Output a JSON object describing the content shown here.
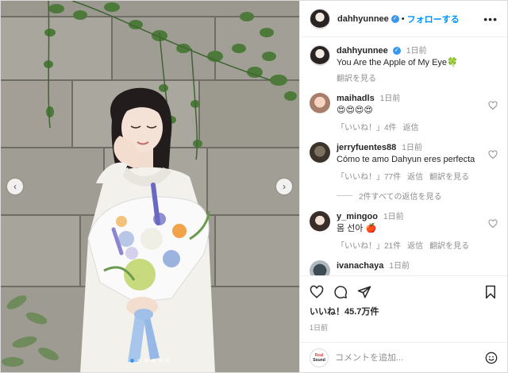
{
  "post": {
    "author": "dahhyunnee",
    "separator": "•",
    "follow_label": "フォローする",
    "more_label": "•••",
    "caption_time": "1日前",
    "caption_text": "You Are the Apple of My Eye🍀",
    "caption_translate": "翻訳を見る",
    "likes": "いいね！45.7万件",
    "posted_time": "1日前"
  },
  "comments": [
    {
      "user": "maihadls",
      "time": "1日前",
      "text": "😍😍😍😍",
      "likes": "「いいね！」4件",
      "reply": "返信",
      "translate": ""
    },
    {
      "user": "jerryfuentes88",
      "time": "1日前",
      "text": "Cómo te amo Dahyun eres perfecta",
      "likes": "「いいね！」77件",
      "reply": "返信",
      "translate": "翻訳を見る"
    },
    {
      "user": "y_mingoo",
      "time": "1日前",
      "text": "몸 선아 🍎",
      "likes": "「いいね！」21件",
      "reply": "返信",
      "translate": "翻訳を見る"
    },
    {
      "user": "ivanachaya",
      "time": "1日前"
    }
  ],
  "view_replies": "2件すべての返信を見る",
  "add_comment": {
    "placeholder": "コメントを追加...",
    "watermark_line1": "Real",
    "watermark_line2": "Sound"
  },
  "carousel": {
    "total": 6,
    "active": 0
  },
  "colors": {
    "accent": "#0095f6",
    "verified": "#3897f0",
    "muted": "#8e8e8e"
  },
  "icons": [
    "heart-icon",
    "comment-icon",
    "share-icon",
    "bookmark-icon",
    "more-icon",
    "emoji-icon",
    "chevron-left-icon",
    "chevron-right-icon"
  ]
}
